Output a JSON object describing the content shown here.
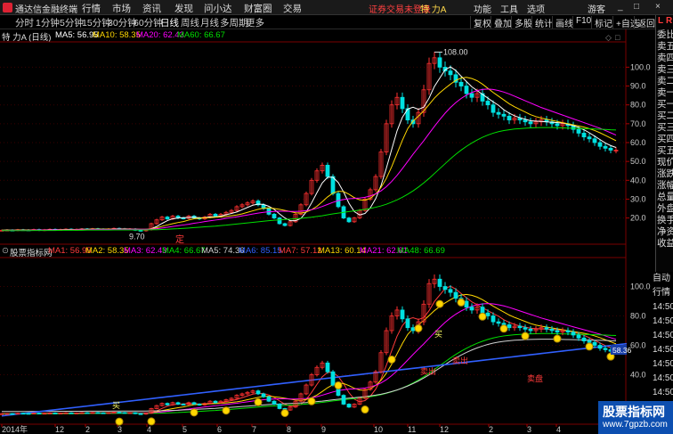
{
  "app": {
    "title": "通达信金融终端",
    "menu": [
      "行情",
      "市场",
      "资讯",
      "发现",
      "问小达",
      "财富圈",
      "交易"
    ],
    "status_alert": "证券交易未登录",
    "stock_title": "特 力A",
    "right_menu": [
      "功能",
      "工具",
      "选项",
      "游客"
    ],
    "window_buttons": [
      "_",
      "□",
      "×"
    ]
  },
  "periods": {
    "tabs": [
      "分时",
      "1分钟",
      "5分钟",
      "15分钟",
      "30分钟",
      "60分钟",
      "日线",
      "周线",
      "月线",
      "多周期",
      "更多"
    ],
    "active": "日线"
  },
  "toolbar": [
    "复权",
    "叠加",
    "多股",
    "统计",
    "画线",
    "F10",
    "标记",
    "+自选",
    "返回"
  ],
  "main_chart": {
    "stock_label": "特 力A (日线)",
    "ma_legend": [
      {
        "label": "MA5: 56.95",
        "color": "#ffffff"
      },
      {
        "label": "MA10: 58.35",
        "color": "#ffd700"
      },
      {
        "label": "MA20: 62.43",
        "color": "#ff00ff"
      },
      {
        "label": "MA60: 66.67",
        "color": "#00e000"
      }
    ],
    "high_marker": "108.00",
    "low_marker": "9.70",
    "ding_label": "定",
    "y_axis_ticks": [
      "100.0",
      "90.0",
      "80.0",
      "70.0",
      "60.0",
      "50.0",
      "40.0",
      "30.0",
      "20.0"
    ]
  },
  "indicator": {
    "name": "股票指标网",
    "legend": [
      {
        "label": "MA1: 56.95",
        "color": "#ff3b3b"
      },
      {
        "label": "MA2: 58.35",
        "color": "#ffd700"
      },
      {
        "label": "MA3: 62.43",
        "color": "#ff00ff"
      },
      {
        "label": "MA4: 66.67",
        "color": "#00e000"
      },
      {
        "label": "MA5: 74.36",
        "color": "#d0d0d0"
      },
      {
        "label": "MA6: 85.15",
        "color": "#3060ff"
      },
      {
        "label": "MA7: 57.12",
        "color": "#ff3b3b"
      },
      {
        "label": "MA13: 60.14",
        "color": "#ffd700"
      },
      {
        "label": "MA21: 62.61",
        "color": "#ff00ff"
      },
      {
        "label": "MA48: 66.69",
        "color": "#00e000"
      }
    ],
    "y_axis_ticks": [
      "100.0",
      "80.0",
      "60.0",
      "40.0"
    ],
    "current_value": "58.36",
    "signal_labels": [
      "买",
      "卖出",
      "卖出",
      "买",
      "卖盘"
    ]
  },
  "x_axis": [
    "2014年",
    "12",
    "2",
    "3",
    "4",
    "5",
    "6",
    "7",
    "8",
    "9",
    "10",
    "11",
    "12",
    "2",
    "3",
    "4"
  ],
  "side_panel": {
    "header": [
      "L",
      "R"
    ],
    "items": [
      "委比",
      "卖五",
      "卖四",
      "卖三",
      "卖二",
      "卖一",
      "买一",
      "买二",
      "买三",
      "买四",
      "买五",
      "现价",
      "涨跌",
      "涨幅",
      "总量",
      "外盘",
      "换手",
      "净资",
      "收益"
    ]
  },
  "indicator_side": {
    "items": [
      "自动",
      "行情",
      "14:50",
      "14:50",
      "14:50",
      "14:50",
      "14:50",
      "14:50",
      "14:50",
      "14:50",
      "14:50"
    ]
  },
  "watermark": {
    "name": "股票指标网",
    "url": "www.7gpzb.com"
  },
  "chart_data": {
    "type": "line",
    "ylim": [
      8,
      112
    ],
    "x": [
      0,
      6,
      12,
      18,
      24,
      30,
      36,
      42,
      48,
      54,
      60,
      66,
      72,
      78,
      84,
      90,
      96,
      102,
      108,
      114,
      120,
      126,
      132,
      138,
      144,
      150,
      156,
      162,
      168,
      174,
      180,
      186,
      192,
      198,
      204,
      210,
      216,
      222,
      228,
      234,
      240,
      246,
      252,
      258,
      264,
      270,
      276,
      282,
      288,
      294,
      300,
      306,
      312,
      318,
      324,
      330,
      336,
      342,
      348,
      354,
      360,
      366,
      372,
      378,
      384,
      390,
      396,
      402,
      408,
      414,
      420,
      426,
      432,
      438,
      444,
      450,
      456,
      462,
      468,
      474,
      480,
      486,
      492,
      498,
      504,
      510,
      516,
      522,
      528,
      534,
      540,
      546,
      552,
      558,
      564,
      570,
      576,
      582,
      588,
      594,
      600,
      606,
      612,
      618,
      624,
      630,
      636,
      642,
      648,
      654,
      660,
      666,
      672,
      678,
      684,
      690,
      696,
      702
    ],
    "close": [
      13.5,
      13.6,
      13.4,
      13.8,
      13.7,
      13.6,
      13.9,
      13.5,
      13.8,
      14.0,
      13.7,
      13.9,
      14.1,
      13.8,
      14.0,
      14.2,
      14.0,
      14.3,
      14.1,
      13.9,
      14.2,
      14.5,
      14.3,
      14.0,
      14.2,
      13.5,
      13.2,
      13.8,
      17,
      19,
      20.5,
      19.5,
      21,
      20,
      19.8,
      21,
      20,
      19.5,
      20.5,
      22,
      21,
      22,
      23,
      24,
      26,
      27,
      28,
      29,
      27,
      25,
      22,
      20,
      17,
      16,
      18,
      22,
      27,
      33,
      40,
      45,
      48,
      42,
      33,
      26,
      20,
      18,
      20,
      24,
      30,
      35,
      42,
      55,
      70,
      80,
      84,
      78,
      72,
      70,
      76,
      88,
      102,
      105,
      100,
      98,
      96,
      92,
      90,
      86,
      84,
      86,
      82,
      80,
      76,
      75,
      74,
      72,
      73,
      72,
      71,
      70,
      71,
      72,
      71,
      70,
      69,
      70,
      69,
      67,
      65,
      63,
      62,
      60,
      58,
      57,
      56,
      56
    ],
    "series": [
      {
        "name": "MA5",
        "values": [
          13.5,
          13.6,
          13.5,
          13.6,
          13.6,
          13.7,
          13.7,
          13.7,
          13.7,
          13.8,
          13.8,
          13.8,
          13.9,
          13.9,
          13.9,
          14.0,
          14.0,
          14.1,
          14.1,
          14.1,
          14.1,
          14.2,
          14.2,
          14.2,
          14.2,
          14.1,
          13.9,
          13.8,
          14.3,
          15.5,
          17.1,
          18.6,
          19.6,
          20.0,
          20.2,
          20.3,
          20.4,
          20.1,
          20.2,
          20.6,
          20.6,
          21.0,
          21.7,
          22.4,
          23.2,
          24.4,
          25.6,
          26.8,
          27.4,
          27.2,
          26.2,
          24.6,
          22.2,
          20.0,
          18.6,
          18.6,
          19.8,
          23.2,
          28.0,
          33.4,
          38.6,
          41.6,
          41.6,
          38.8,
          33.8,
          27.8,
          23.4,
          21.6,
          22.4,
          25.4,
          30.2,
          37.2,
          46.4,
          56.4,
          66.2,
          73.4,
          77.8,
          78.8,
          77.6,
          78.8,
          83.6,
          89.8,
          94.2,
          98.6,
          100.2,
          98.2,
          95.2,
          92.4,
          89.6,
          87.6,
          85.6,
          83.6,
          81.6,
          79.8,
          77.4,
          75.6,
          74.2,
          73.2,
          72.4,
          71.6,
          71.4,
          71.2,
          71.0,
          70.8,
          70.6,
          70.4,
          69.8,
          69.0,
          68.0,
          66.8,
          65.2,
          63.4,
          61.6,
          59.8,
          58.4,
          57.4
        ]
      },
      {
        "name": "MA10",
        "values": [
          13.5,
          13.5,
          13.5,
          13.6,
          13.6,
          13.6,
          13.6,
          13.6,
          13.7,
          13.7,
          13.7,
          13.8,
          13.8,
          13.8,
          13.9,
          13.9,
          13.9,
          14.0,
          14.0,
          14.0,
          14.1,
          14.1,
          14.1,
          14.2,
          14.1,
          14.1,
          14.0,
          14.0,
          14.2,
          14.8,
          15.6,
          16.3,
          17.0,
          17.6,
          18.1,
          18.9,
          19.6,
          19.9,
          20.1,
          20.2,
          20.4,
          20.6,
          20.8,
          21.2,
          21.6,
          22.2,
          23.0,
          23.8,
          24.6,
          25.2,
          25.4,
          25.0,
          24.6,
          24.0,
          23.4,
          22.8,
          22.6,
          23.2,
          24.4,
          26.2,
          28.6,
          31.2,
          33.2,
          34.2,
          34.0,
          32.6,
          30.8,
          29.6,
          29.4,
          30.4,
          32.8,
          36.2,
          41.0,
          47.2,
          54.2,
          61.2,
          67.4,
          71.4,
          74.0,
          76.8,
          80.2,
          83.6,
          86.4,
          88.8,
          91.0,
          93.0,
          94.2,
          94.6,
          94.0,
          92.8,
          91.0,
          88.8,
          86.6,
          84.6,
          82.6,
          80.6,
          79.0,
          77.6,
          76.2,
          74.8,
          73.8,
          73.0,
          72.4,
          71.8,
          71.2,
          70.6,
          70.0,
          69.4,
          68.8,
          68.2,
          67.4,
          66.4,
          65.2,
          63.8,
          62.4,
          61.0
        ]
      },
      {
        "name": "MA20",
        "values": [
          13.4,
          13.4,
          13.5,
          13.5,
          13.5,
          13.5,
          13.6,
          13.6,
          13.6,
          13.6,
          13.7,
          13.7,
          13.7,
          13.7,
          13.8,
          13.8,
          13.8,
          13.9,
          13.9,
          13.9,
          13.9,
          14.0,
          14.0,
          14.0,
          14.0,
          14.0,
          14.0,
          14.0,
          14.1,
          14.3,
          14.7,
          15.1,
          15.5,
          15.9,
          16.3,
          16.7,
          17.2,
          17.6,
          18.1,
          18.5,
          18.9,
          19.3,
          19.8,
          20.2,
          20.6,
          21.1,
          21.6,
          22.1,
          22.6,
          23.0,
          23.3,
          23.5,
          23.6,
          23.6,
          23.5,
          23.5,
          23.6,
          23.9,
          24.4,
          25.1,
          26.1,
          27.2,
          28.3,
          29.2,
          29.8,
          30.2,
          30.4,
          30.6,
          31.0,
          31.7,
          32.8,
          34.4,
          36.6,
          39.4,
          42.6,
          46.2,
          50.0,
          53.8,
          57.4,
          61.0,
          64.8,
          68.6,
          72.2,
          75.6,
          78.6,
          81.2,
          83.4,
          85.2,
          86.6,
          87.6,
          88.2,
          88.4,
          88.2,
          87.6,
          86.8,
          85.8,
          84.6,
          83.4,
          82.2,
          81.0,
          79.8,
          78.6,
          77.6,
          76.6,
          75.6,
          74.6,
          73.6,
          72.6,
          71.6,
          70.6,
          69.6,
          68.6,
          67.6,
          66.4,
          65.2,
          64.0
        ]
      },
      {
        "name": "MA60",
        "values": [
          13.3,
          13.3,
          13.3,
          13.3,
          13.3,
          13.3,
          13.4,
          13.4,
          13.4,
          13.4,
          13.4,
          13.5,
          13.5,
          13.5,
          13.5,
          13.5,
          13.6,
          13.6,
          13.6,
          13.6,
          13.6,
          13.7,
          13.7,
          13.7,
          13.7,
          13.7,
          13.7,
          13.7,
          13.8,
          13.8,
          13.9,
          14.0,
          14.2,
          14.3,
          14.5,
          14.7,
          14.9,
          15.1,
          15.3,
          15.5,
          15.7,
          16.0,
          16.2,
          16.5,
          16.8,
          17.1,
          17.4,
          17.7,
          18.0,
          18.3,
          18.6,
          18.8,
          19.0,
          19.2,
          19.4,
          19.6,
          19.8,
          20.1,
          20.4,
          20.8,
          21.2,
          21.7,
          22.2,
          22.6,
          23.0,
          23.4,
          23.8,
          24.2,
          24.6,
          25.1,
          25.7,
          26.4,
          27.3,
          28.4,
          29.6,
          31.0,
          32.6,
          34.4,
          36.4,
          38.6,
          41.0,
          43.6,
          46.2,
          48.8,
          51.4,
          53.8,
          56.0,
          58.0,
          59.8,
          61.4,
          62.8,
          64.0,
          65.0,
          65.8,
          66.4,
          66.8,
          67.2,
          67.4,
          67.6,
          67.8,
          67.9,
          68.0,
          68.0,
          68.0,
          67.9,
          67.8,
          67.7,
          67.6,
          67.5,
          67.4,
          67.3,
          67.2,
          67.1,
          67.0,
          66.8,
          66.7
        ]
      }
    ]
  }
}
